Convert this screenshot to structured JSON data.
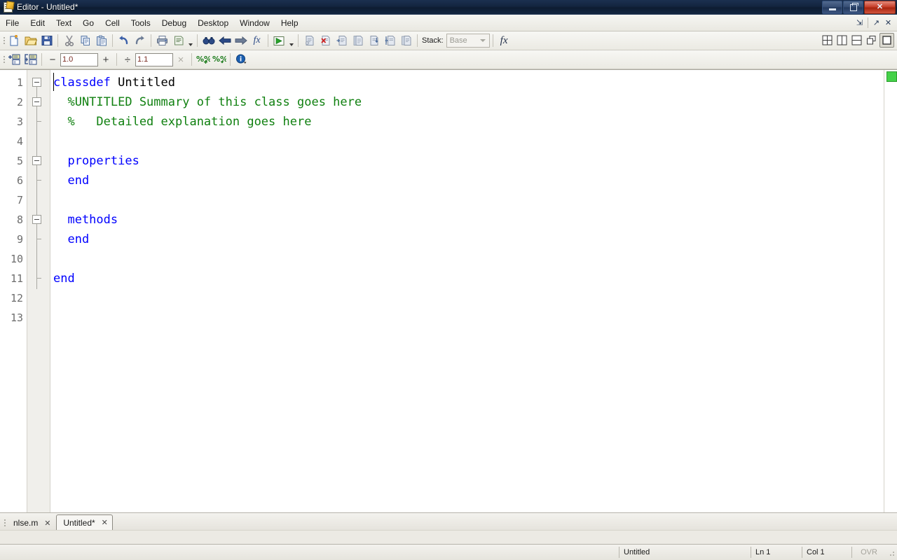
{
  "window": {
    "title": "Editor - Untitled*",
    "icon": "editor-document-icon",
    "minimize_label": "",
    "restore_label": "",
    "close_label": "✕"
  },
  "menubar": {
    "items": [
      {
        "label": "File",
        "name": "menu-file"
      },
      {
        "label": "Edit",
        "name": "menu-edit"
      },
      {
        "label": "Text",
        "name": "menu-text"
      },
      {
        "label": "Go",
        "name": "menu-go"
      },
      {
        "label": "Cell",
        "name": "menu-cell"
      },
      {
        "label": "Tools",
        "name": "menu-tools"
      },
      {
        "label": "Debug",
        "name": "menu-debug"
      },
      {
        "label": "Desktop",
        "name": "menu-desktop"
      },
      {
        "label": "Window",
        "name": "menu-window"
      },
      {
        "label": "Help",
        "name": "menu-help"
      }
    ],
    "right_buttons": [
      {
        "name": "dock-arrow-icon",
        "glyph": "⇲"
      },
      {
        "name": "undock-arrow-icon",
        "glyph": "↗"
      },
      {
        "name": "close-panel-icon",
        "glyph": "✕"
      }
    ]
  },
  "toolbar_main": {
    "buttons": [
      {
        "name": "new-file-icon",
        "tooltip": "New"
      },
      {
        "name": "open-file-icon",
        "tooltip": "Open"
      },
      {
        "name": "save-icon",
        "tooltip": "Save"
      },
      {
        "name": "cut-icon",
        "tooltip": "Cut"
      },
      {
        "name": "copy-icon",
        "tooltip": "Copy"
      },
      {
        "name": "paste-icon",
        "tooltip": "Paste"
      },
      {
        "name": "undo-icon",
        "tooltip": "Undo"
      },
      {
        "name": "redo-icon",
        "tooltip": "Redo"
      },
      {
        "name": "print-icon",
        "tooltip": "Print"
      },
      {
        "name": "publish-icon",
        "tooltip": "Publish"
      },
      {
        "name": "find-icon",
        "tooltip": "Find"
      },
      {
        "name": "back-arrow-icon",
        "tooltip": "Back"
      },
      {
        "name": "forward-arrow-icon",
        "tooltip": "Forward"
      },
      {
        "name": "function-browser-icon",
        "tooltip": "Function Browser"
      },
      {
        "name": "run-icon",
        "tooltip": "Run"
      },
      {
        "name": "set-breakpoint-icon",
        "tooltip": "Set/Clear Breakpoint"
      },
      {
        "name": "clear-breakpoints-icon",
        "tooltip": "Clear All Breakpoints"
      },
      {
        "name": "step-icon",
        "tooltip": "Step"
      },
      {
        "name": "step-in-icon",
        "tooltip": "Step In"
      },
      {
        "name": "step-out-icon",
        "tooltip": "Step Out"
      },
      {
        "name": "continue-icon",
        "tooltip": "Continue"
      },
      {
        "name": "exit-debug-icon",
        "tooltip": "Exit Debug Mode"
      }
    ],
    "stack_label": "Stack:",
    "stack_value": "Base",
    "fx_label": "fx"
  },
  "toolbar_cell": {
    "insert_cell_label": "insert-cell",
    "insert_cell_division_label": "insert-cell-division",
    "minus_label": "−",
    "decrement_value": "1.0",
    "plus_label": "+",
    "divide_label": "÷",
    "divide_value": "1.1",
    "times_label": "×",
    "eval_cell_label": "%%",
    "eval_cell_advance_label": "%%",
    "help_label": "i"
  },
  "layout_buttons": [
    {
      "name": "tile-grid-icon",
      "selected": false
    },
    {
      "name": "split-vertical-icon",
      "selected": false
    },
    {
      "name": "split-horizontal-icon",
      "selected": false
    },
    {
      "name": "float-window-icon",
      "selected": false
    },
    {
      "name": "maximize-document-icon",
      "selected": true
    }
  ],
  "editor": {
    "line_numbers": [
      "1",
      "2",
      "3",
      "4",
      "5",
      "6",
      "7",
      "8",
      "9",
      "10",
      "11",
      "12",
      "13"
    ],
    "lines": [
      {
        "n": 1,
        "fold": "open",
        "tokens": [
          {
            "t": "classdef",
            "c": "kw"
          },
          {
            "t": " Untitled",
            "c": "plain"
          }
        ]
      },
      {
        "n": 2,
        "fold": "open",
        "tokens": [
          {
            "t": "  %UNTITLED Summary of this class goes here",
            "c": "cmt"
          }
        ]
      },
      {
        "n": 3,
        "fold": "tick",
        "tokens": [
          {
            "t": "  %   Detailed explanation goes here",
            "c": "cmt"
          }
        ]
      },
      {
        "n": 4,
        "fold": "line",
        "tokens": []
      },
      {
        "n": 5,
        "fold": "open",
        "tokens": [
          {
            "t": "  properties",
            "c": "kw"
          }
        ]
      },
      {
        "n": 6,
        "fold": "tick",
        "tokens": [
          {
            "t": "  end",
            "c": "kw"
          }
        ]
      },
      {
        "n": 7,
        "fold": "line",
        "tokens": []
      },
      {
        "n": 8,
        "fold": "open",
        "tokens": [
          {
            "t": "  methods",
            "c": "kw"
          }
        ]
      },
      {
        "n": 9,
        "fold": "tick",
        "tokens": [
          {
            "t": "  end",
            "c": "kw"
          }
        ]
      },
      {
        "n": 10,
        "fold": "line",
        "tokens": []
      },
      {
        "n": 11,
        "fold": "endtick",
        "tokens": [
          {
            "t": "end",
            "c": "kw"
          }
        ]
      },
      {
        "n": 12,
        "fold": "none",
        "tokens": []
      },
      {
        "n": 13,
        "fold": "none",
        "tokens": []
      }
    ],
    "lint_status": "ok",
    "caret_line": 1,
    "caret_col": 1
  },
  "tabs": [
    {
      "label": "nlse.m",
      "active": false,
      "close": "✕"
    },
    {
      "label": "Untitled*",
      "active": true,
      "close": "✕"
    }
  ],
  "statusbar": {
    "filename": "Untitled",
    "line": "Ln  1",
    "column": "Col  1",
    "overwrite": "OVR"
  },
  "colors": {
    "keyword": "#0000ff",
    "comment": "#108010",
    "lint_ok": "#44d148",
    "titlebar": "#13253f",
    "close_button": "#c7402b"
  }
}
